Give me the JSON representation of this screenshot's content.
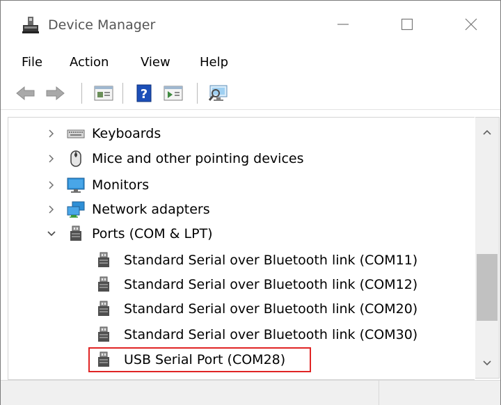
{
  "window": {
    "title": "Device Manager",
    "controls": {
      "minimize": "minimize",
      "maximize": "maximize",
      "close": "close"
    }
  },
  "menu": {
    "items": [
      {
        "label": "File"
      },
      {
        "label": "Action"
      },
      {
        "label": "View"
      },
      {
        "label": "Help"
      }
    ]
  },
  "toolbar": {
    "buttons": [
      {
        "icon": "back-arrow-icon"
      },
      {
        "icon": "forward-arrow-icon"
      },
      {
        "icon": "properties-icon"
      },
      {
        "icon": "help-icon"
      },
      {
        "icon": "update-driver-icon"
      },
      {
        "icon": "scan-hardware-icon"
      }
    ]
  },
  "tree": {
    "nodes": [
      {
        "label": "Keyboards",
        "icon": "keyboard-icon",
        "expanded": false
      },
      {
        "label": "Mice and other pointing devices",
        "icon": "mouse-icon",
        "expanded": false
      },
      {
        "label": "Monitors",
        "icon": "monitor-icon",
        "expanded": false
      },
      {
        "label": "Network adapters",
        "icon": "network-adapter-icon",
        "expanded": false
      },
      {
        "label": "Ports (COM & LPT)",
        "icon": "port-icon",
        "expanded": true
      }
    ],
    "ports": [
      {
        "label": "Standard Serial over Bluetooth link (COM11)",
        "icon": "port-icon"
      },
      {
        "label": "Standard Serial over Bluetooth link (COM12)",
        "icon": "port-icon"
      },
      {
        "label": "Standard Serial over Bluetooth link (COM20)",
        "icon": "port-icon"
      },
      {
        "label": "Standard Serial over Bluetooth link (COM30)",
        "icon": "port-icon"
      },
      {
        "label": "USB Serial Port (COM28)",
        "icon": "port-icon",
        "highlighted": true
      }
    ]
  },
  "colors": {
    "highlight_border": "#e02424",
    "monitor_blue": "#2e8fd6",
    "help_blue": "#1c4fb8"
  }
}
